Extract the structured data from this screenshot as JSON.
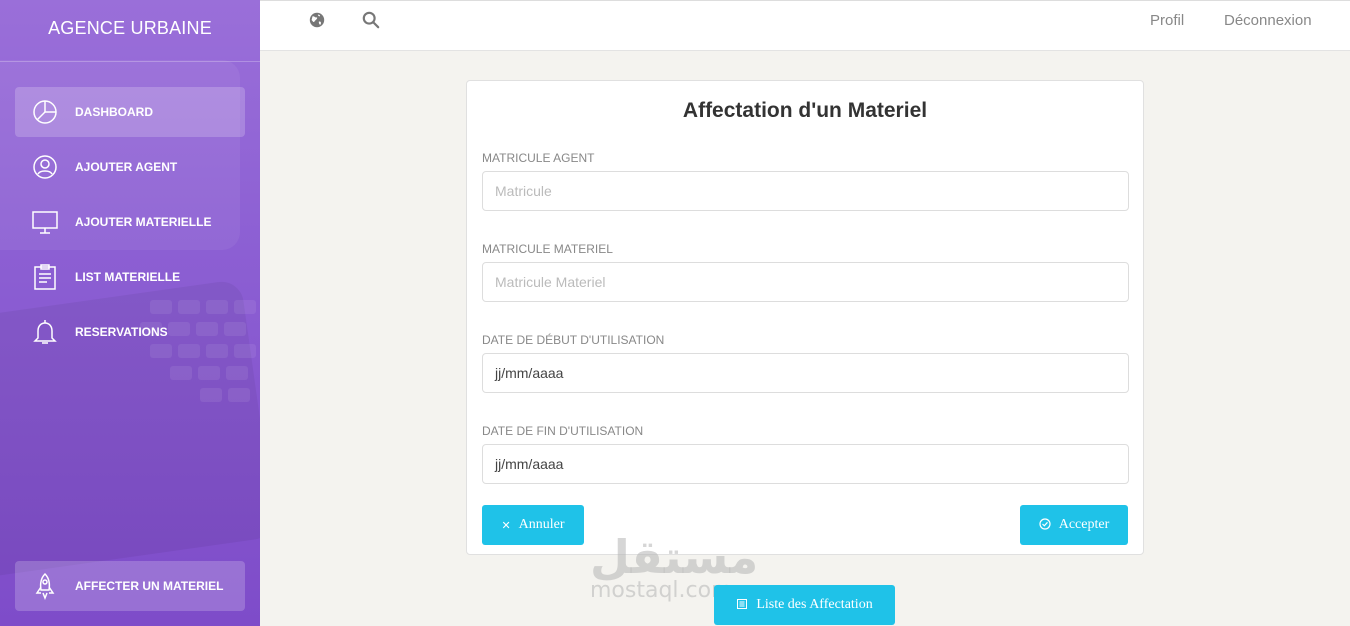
{
  "sidebar": {
    "brand": "AGENCE URBAINE",
    "items": [
      {
        "label": "DASHBOARD",
        "icon": "pie-chart-icon",
        "active": true
      },
      {
        "label": "AJOUTER AGENT",
        "icon": "user-icon",
        "active": false
      },
      {
        "label": "AJOUTER MATERIELLE",
        "icon": "monitor-icon",
        "active": false
      },
      {
        "label": "LIST MATERIELLE",
        "icon": "clipboard-icon",
        "active": false
      },
      {
        "label": "RESERVATIONS",
        "icon": "bell-icon",
        "active": false
      }
    ],
    "bottom_item": {
      "label": "AFFECTER UN MATERIEL",
      "icon": "rocket-icon"
    }
  },
  "topbar": {
    "icons": [
      "globe-icon",
      "search-icon"
    ],
    "profile_label": "Profil",
    "logout_label": "Déconnexion"
  },
  "form": {
    "title": "Affectation d'un Materiel",
    "fields": {
      "agent": {
        "label": "MATRICULE AGENT",
        "placeholder": "Matricule"
      },
      "materiel": {
        "label": "MATRICULE MATERIEL",
        "placeholder": "Matricule Materiel"
      },
      "start": {
        "label": "DATE DE DÉBUT D'UTILISATION",
        "value": "jj/mm/aaaa"
      },
      "end": {
        "label": "DATE DE FIN D'UTILISATION",
        "value": "jj/mm/aaaa"
      }
    },
    "cancel_label": "Annuler",
    "accept_label": "Accepter"
  },
  "list_button_label": "Liste des Affectation",
  "watermark": {
    "arabic": "مستقل",
    "latin": "mostaql.com"
  },
  "colors": {
    "sidebar": "#8c5fd3",
    "button": "#1fc2e8",
    "background": "#f4f3ef"
  }
}
